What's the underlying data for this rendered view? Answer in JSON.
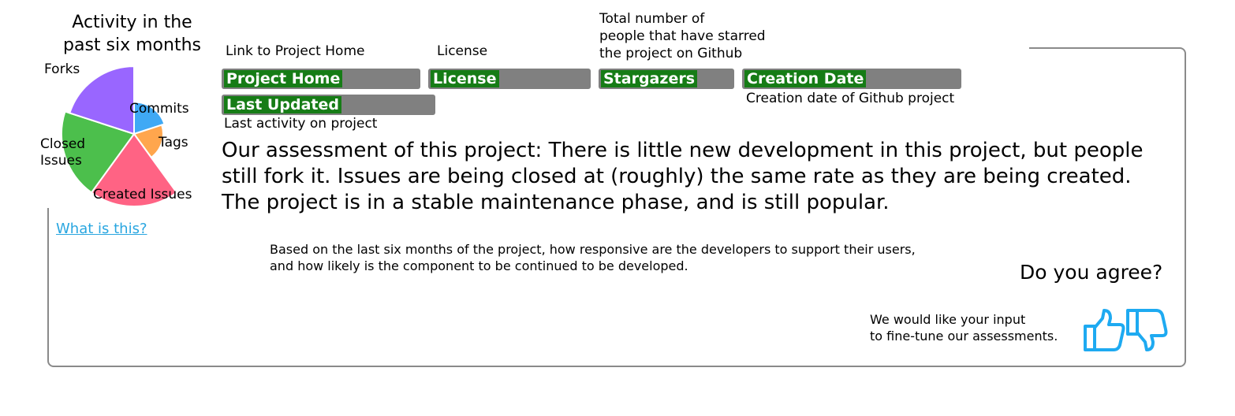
{
  "chart_panel": {
    "title_line1": "Activity in the",
    "title_line2": "past six months",
    "what_link": "What is this?"
  },
  "chart_data": {
    "type": "pie",
    "title": "Activity in the past six months",
    "slices": [
      {
        "label": "Commits",
        "value": 6,
        "color": "#3fa9f5"
      },
      {
        "label": "Tags",
        "value": 5,
        "color": "#ffa64d"
      },
      {
        "label": "Created Issues",
        "value": 31,
        "color": "#ff6384"
      },
      {
        "label": "Closed Issues",
        "value": 31,
        "color": "#4cbf4c"
      },
      {
        "label": "Forks",
        "value": 27,
        "color": "#9966ff"
      }
    ]
  },
  "fields": {
    "home": {
      "desc": "Link to Project Home",
      "label": "Project Home"
    },
    "license": {
      "desc": "License",
      "label": "License"
    },
    "stars": {
      "desc_line1": "Total number of",
      "desc_line2": "people that have starred",
      "desc_line3": "the project on Github",
      "label": "Stargazers"
    },
    "created": {
      "label": "Creation Date",
      "desc": "Creation date of Github project"
    },
    "updated": {
      "label": "Last Updated",
      "desc": "Last activity on project"
    }
  },
  "assessment": "Our assessment of this project: There is little new development in this project, but people still fork it. Issues are being closed at (roughly) the same rate as they are being created. The project is in a stable maintenance phase, and is still popular.",
  "explanation_line1": "Based on the last six months of the project, how responsive are the developers to support their users,",
  "explanation_line2": "and how likely is the component to be continued to be developed.",
  "feedback": {
    "question": "Do you agree?",
    "line1": "We would like your input",
    "line2": "to fine-tune our assessments."
  },
  "colors": {
    "label_green": "#167c16",
    "bar_gray": "#808080",
    "link_blue": "#29a6e0",
    "thumb_blue": "#1eaaf1"
  }
}
